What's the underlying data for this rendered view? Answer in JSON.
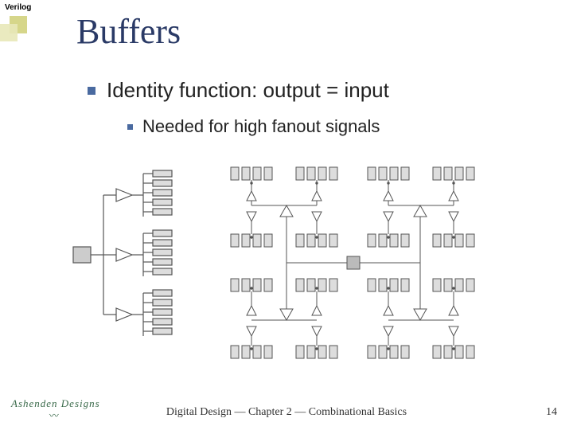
{
  "tag": "Verilog",
  "title": "Buffers",
  "bullet1": "Identity function: output = input",
  "bullet2": "Needed for high fanout signals",
  "footer": "Digital Design — Chapter 2 — Combinational Basics",
  "pagenum": "14",
  "logo_text": "Ashenden Designs"
}
